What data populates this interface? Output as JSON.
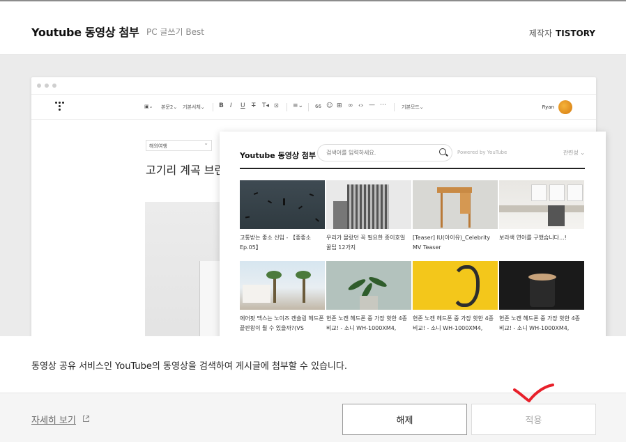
{
  "header": {
    "title": "Youtube 동영상 첨부",
    "subtitle": "PC 글쓰기 Best",
    "maker_label": "제작자",
    "maker_name": "TISTORY"
  },
  "editor": {
    "toolbar": {
      "body_style": "본문2",
      "font": "기본서체",
      "mode": "기본모드"
    },
    "user_name": "Ryan",
    "category": "해외여행",
    "post_title": "고기리 계곡 브런"
  },
  "youtube_popup": {
    "title": "Youtube 동영상 첨부",
    "search_placeholder": "검색어를 입력하세요.",
    "powered_by": "Powered by YouTube",
    "sort_label": "관련성",
    "videos": [
      {
        "caption": "고통받는 좋소 신입 - 【좋좋소 Ep.05】"
      },
      {
        "caption": "우리가 몰랐던 꼭 필요한 종이호일 꿀팁 12가지"
      },
      {
        "caption": "[Teaser] IU(아이유)_Celebrity MV Teaser"
      },
      {
        "caption": "보라색 연어를 구했습니다...!"
      },
      {
        "caption": "에어팟 맥스는 노이즈 캔슬링 헤드폰 끝판왕이 될 수 있을까?(VS"
      },
      {
        "caption": "현존 노캔 헤드폰 중 가장 핫한 4종 비교! - 소니 WH-1000XM4,"
      },
      {
        "caption": "현존 노캔 헤드폰 중 가장 핫한 4종 비교! - 소니 WH-1000XM4,"
      },
      {
        "caption": "현존 노캔 헤드폰 중 가장 핫한 4종 비교! - 소니 WH-1000XM4,"
      }
    ]
  },
  "description": "동영상 공유 서비스인 YouTube의 동영상을 검색하여 게시글에 첨부할 수 있습니다.",
  "footer": {
    "detail_link": "자세히 보기",
    "release_button": "해제",
    "apply_button": "적용"
  },
  "colors": {
    "checkmark": "#e8202a",
    "accent_dark": "#222222"
  }
}
